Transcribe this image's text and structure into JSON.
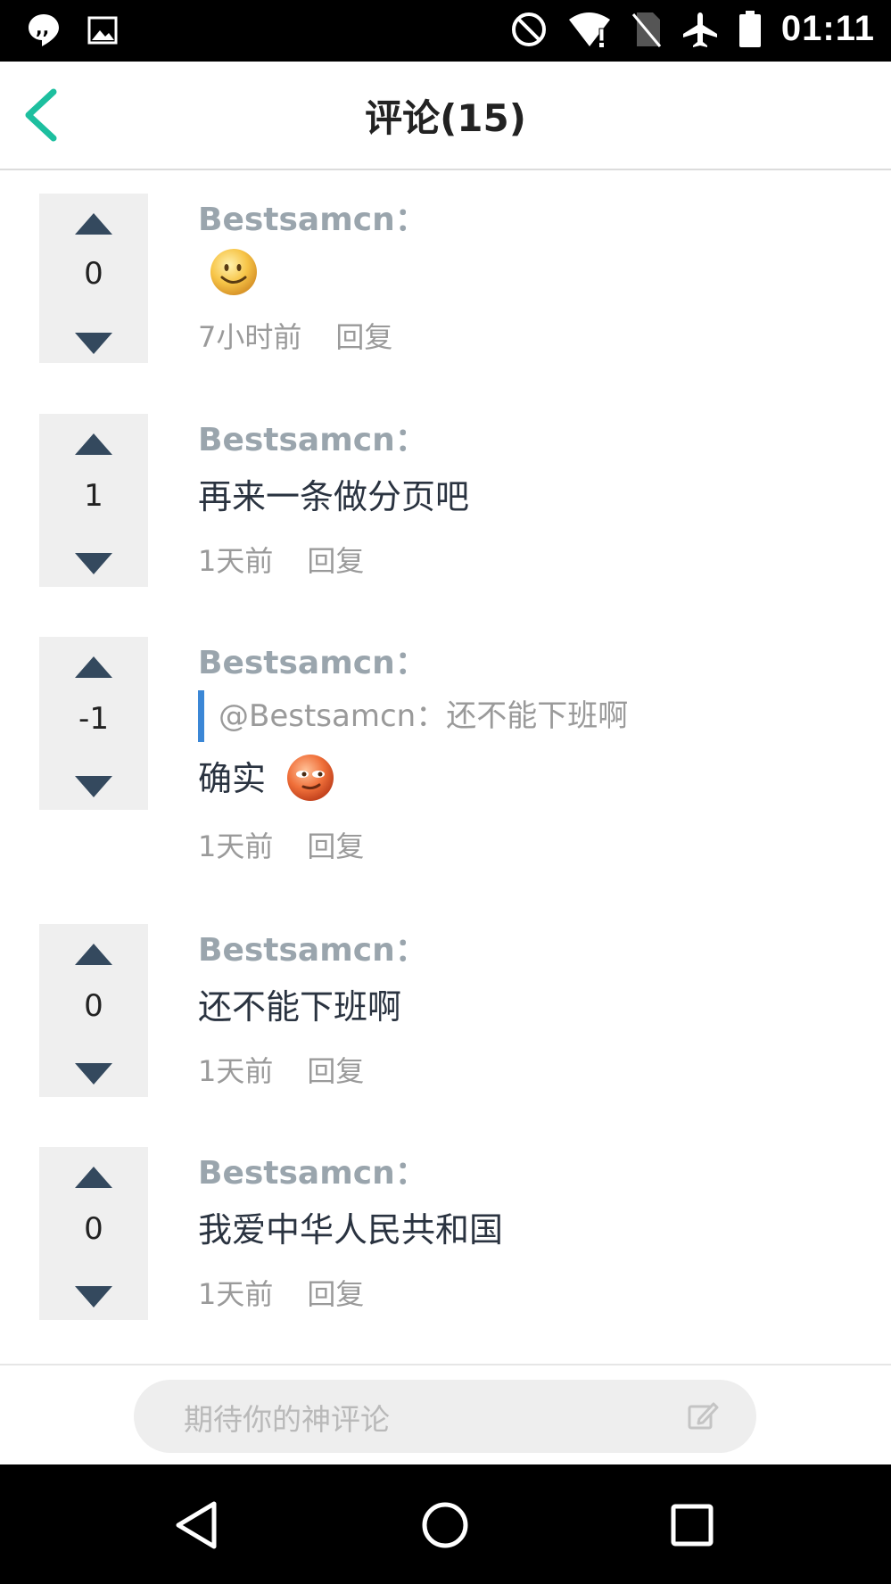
{
  "status_bar": {
    "time": "01:11",
    "left_icons": [
      "quote-bubble-icon",
      "image-icon"
    ],
    "right_icons": [
      "do-not-disturb-icon",
      "wifi-alert-icon",
      "no-sim-icon",
      "airplane-icon",
      "battery-icon"
    ]
  },
  "header": {
    "title": "评论(15)",
    "back_icon": "chevron-left-icon",
    "accent_color": "#1dbf9f"
  },
  "comments": [
    {
      "author": "Bestsamcn：",
      "votes": "0",
      "quote": "",
      "text": "",
      "emoji": "smile-emoji",
      "time": "7小时前",
      "reply": "回复"
    },
    {
      "author": "Bestsamcn：",
      "votes": "1",
      "quote": "",
      "text": "再来一条做分页吧",
      "emoji": "",
      "time": "1天前",
      "reply": "回复"
    },
    {
      "author": "Bestsamcn：",
      "votes": "-1",
      "quote": "@Bestsamcn：还不能下班啊",
      "text": "确实",
      "emoji": "smirk-emoji",
      "time": "1天前",
      "reply": "回复"
    },
    {
      "author": "Bestsamcn：",
      "votes": "0",
      "quote": "",
      "text": "还不能下班啊",
      "emoji": "",
      "time": "1天前",
      "reply": "回复"
    },
    {
      "author": "Bestsamcn：",
      "votes": "0",
      "quote": "",
      "text": "我爱中华人民共和国",
      "emoji": "",
      "time": "1天前",
      "reply": "回复"
    }
  ],
  "comment_input": {
    "placeholder": "期待你的神评论",
    "icon": "edit-icon"
  },
  "nav_bar": {
    "buttons": [
      "back-triangle-icon",
      "home-circle-icon",
      "recents-square-icon"
    ]
  }
}
